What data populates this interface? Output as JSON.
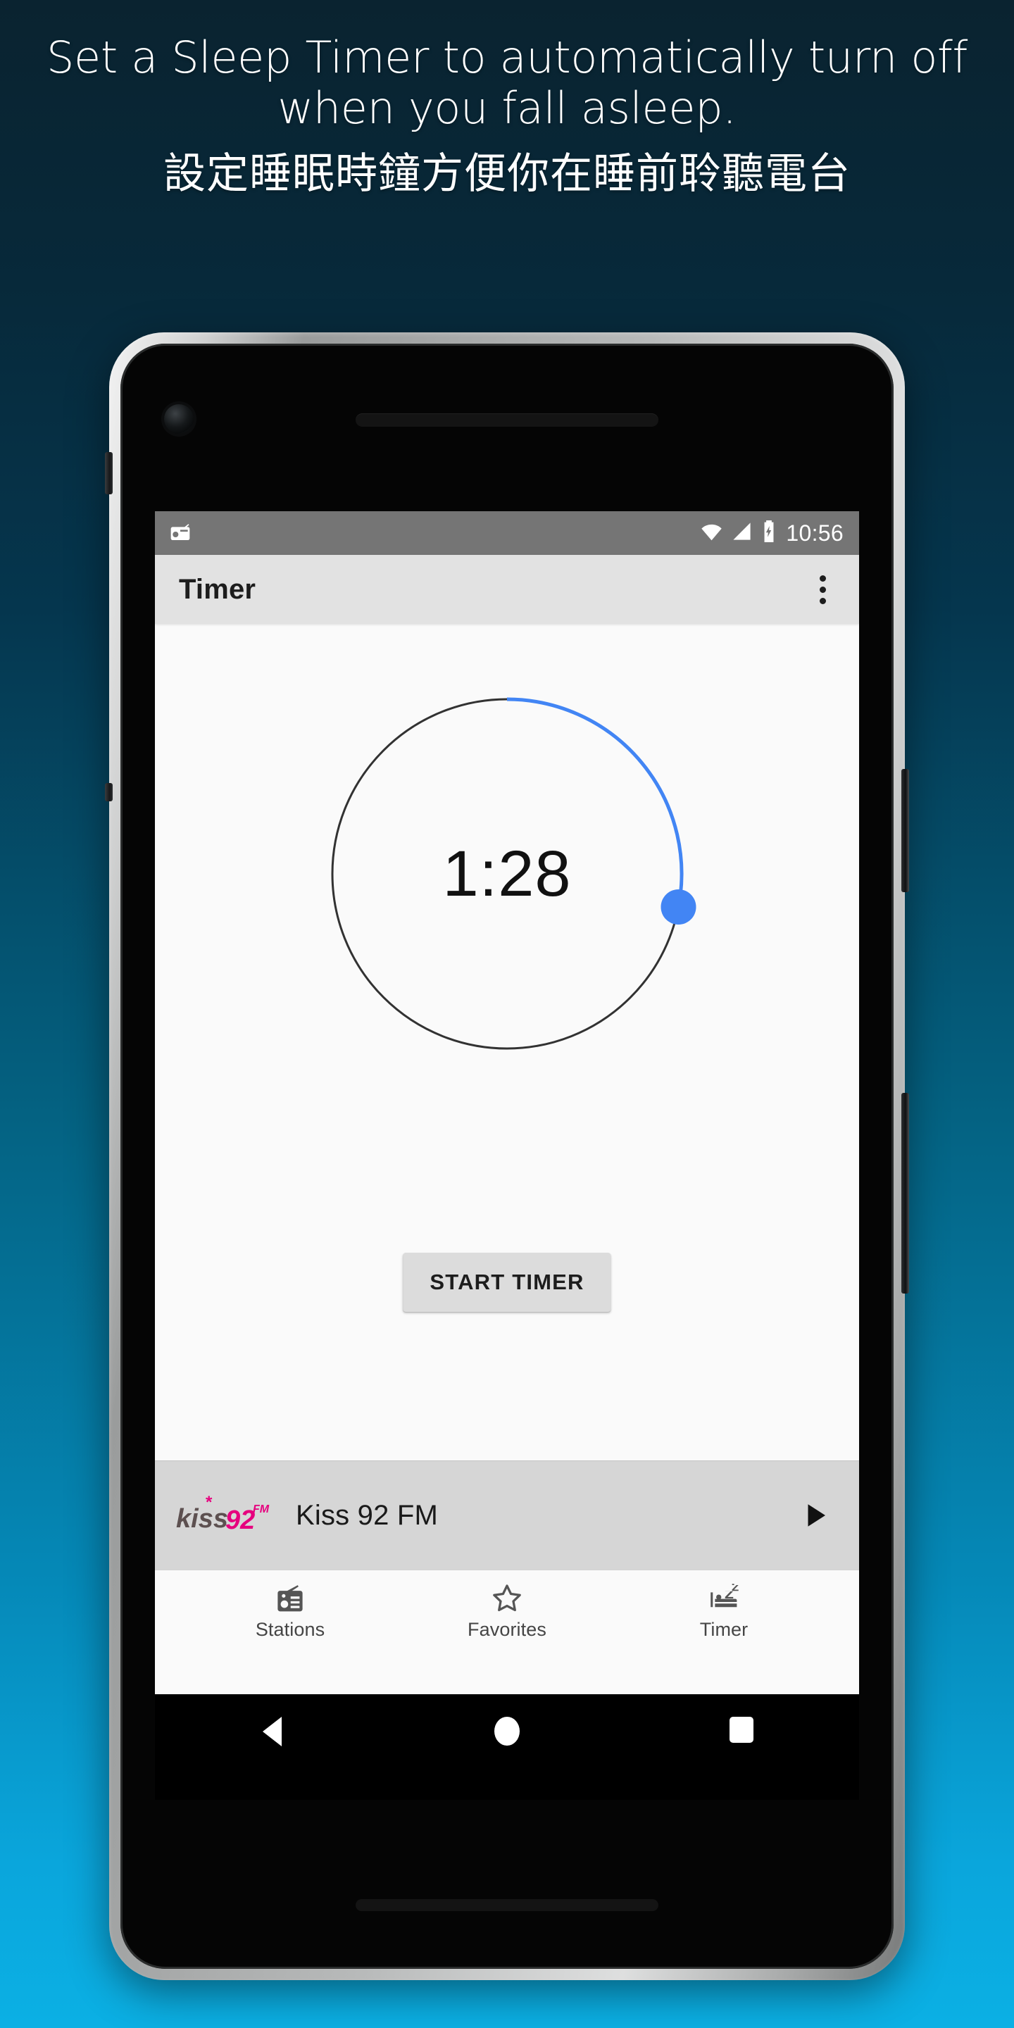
{
  "promo": {
    "headline_en": "Set a Sleep Timer to automatically turn off when you fall asleep.",
    "headline_zh": "設定睡眠時鐘方便你在睡前聆聽電台",
    "background_top_color": "#0a2330",
    "background_bottom_color": "#0bb0e4"
  },
  "status_bar": {
    "notification_icon": "radio-icon",
    "wifi_icon": "wifi-icon",
    "signal_icon": "cell-signal-icon",
    "battery_icon": "battery-charging-icon",
    "time": "10:56"
  },
  "app_bar": {
    "title": "Timer",
    "overflow_icon": "overflow-menu-icon"
  },
  "timer": {
    "value": "1:28",
    "progress_percent": 27,
    "track_color": "#323232",
    "progress_color": "#4285f4",
    "knob_color": "#4285f4",
    "start_button_label": "START TIMER"
  },
  "now_playing": {
    "logo_kiss": "kiss",
    "logo_92": "92",
    "logo_fm": "FM",
    "logo_star": "*",
    "station_name": "Kiss 92 FM",
    "play_icon": "play-icon",
    "logo_gray": "#5d5050",
    "logo_magenta": "#e6007e"
  },
  "bottom_nav": {
    "items": [
      {
        "label": "Stations",
        "icon": "radio-icon"
      },
      {
        "label": "Favorites",
        "icon": "star-outline-icon"
      },
      {
        "label": "Timer",
        "icon": "sleep-bed-icon"
      }
    ]
  },
  "system_nav": {
    "back": "back-triangle-icon",
    "home": "home-circle-icon",
    "recents": "recents-square-icon"
  }
}
